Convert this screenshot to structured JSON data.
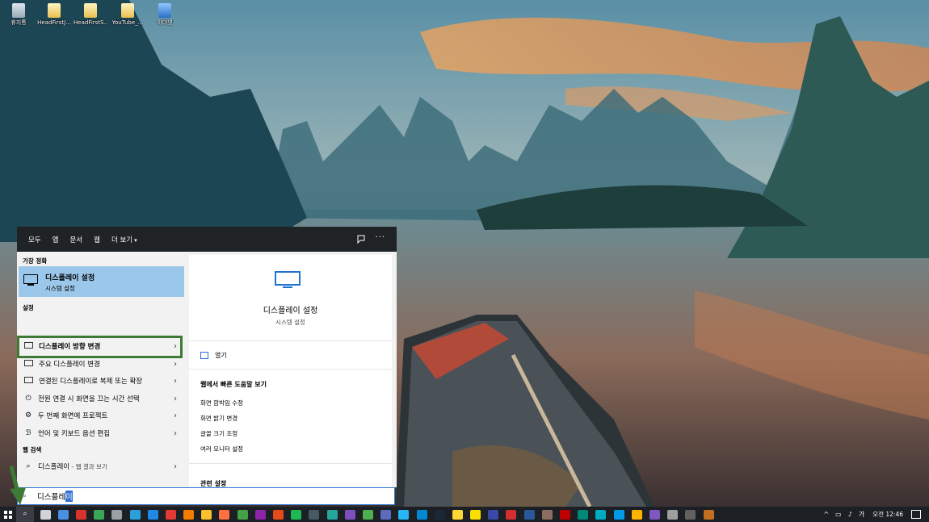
{
  "desktop": {
    "icons": [
      {
        "label": "휴지통",
        "icon": "recycle-bin-icon"
      },
      {
        "label": "HeadFirstJ...",
        "icon": "file-icon"
      },
      {
        "label": "HeadFirstS...",
        "icon": "file-icon"
      },
      {
        "label": "YouTube_...",
        "icon": "file-icon"
      },
      {
        "label": "이더넷",
        "icon": "network-icon"
      }
    ]
  },
  "search_panel": {
    "tabs": [
      {
        "label": "모두"
      },
      {
        "label": "앱"
      },
      {
        "label": "문서"
      },
      {
        "label": "웹"
      },
      {
        "label": "더 보기"
      }
    ],
    "more_caret": "▾",
    "more_options": "···",
    "best_match_title": "가장 정확",
    "best_match": {
      "title": "디스플레이 설정",
      "subtitle": "시스템 설정"
    },
    "settings_title": "설정",
    "settings_items": [
      {
        "label": "디스플레이 방향 변경",
        "icon": "monitor-icon"
      },
      {
        "label": "주요 디스플레이 변경",
        "icon": "monitor-icon"
      },
      {
        "label": "연결된 디스플레이로 복제 또는 확장",
        "icon": "monitor-icon"
      },
      {
        "label": "전원 연결 시 화면을 끄는 시간 선택",
        "icon": "power-icon"
      },
      {
        "label": "두 번째 화면에 프로젝트",
        "icon": "gear-icon"
      },
      {
        "label": "언어 및 키보드 옵션 편집",
        "icon": "language-icon"
      }
    ],
    "web_search_title": "웹 검색",
    "web_search_item": {
      "label": "디스플레이",
      "suffix": " - 웹 결과 보기"
    },
    "detail": {
      "title": "디스플레이 설정",
      "subtitle": "시스템 설정",
      "open_label": "열기",
      "web_help_title": "웹에서 빠른 도움말 보기",
      "help_links": [
        "화면 깜박임 수정",
        "화면 밝기 변경",
        "글꼴 크기 조정",
        "여러 모니터 설정"
      ],
      "related_title": "관련 설정"
    }
  },
  "search_box": {
    "query_prefix": "디스플레",
    "query_selected": "이"
  },
  "taskbar": {
    "apps": [
      {
        "icon": "task-view-icon",
        "color": "#cfd3d8"
      },
      {
        "icon": "mail-icon",
        "color": "#4a90e2"
      },
      {
        "icon": "acrobat-icon",
        "color": "#d9342b"
      },
      {
        "icon": "chrome-icon",
        "color": "#3aa757"
      },
      {
        "icon": "clock-icon",
        "color": "#9aa0a6"
      },
      {
        "icon": "edge-icon",
        "color": "#2b9fd9"
      },
      {
        "icon": "ie-icon",
        "color": "#1e88e5"
      },
      {
        "icon": "opera-icon",
        "color": "#e53935"
      },
      {
        "icon": "firefox-icon",
        "color": "#f57c00"
      },
      {
        "icon": "chrome-icon",
        "color": "#fbc02d"
      },
      {
        "icon": "firefox-icon",
        "color": "#ff7043"
      },
      {
        "icon": "app-icon",
        "color": "#43a047"
      },
      {
        "icon": "app-icon",
        "color": "#8e24aa"
      },
      {
        "icon": "app-icon",
        "color": "#e64a19"
      },
      {
        "icon": "spotify-icon",
        "color": "#1db954"
      },
      {
        "icon": "app-icon",
        "color": "#455a64"
      },
      {
        "icon": "app-icon",
        "color": "#26a69a"
      },
      {
        "icon": "visual-studio-icon",
        "color": "#7b4fbf"
      },
      {
        "icon": "app-icon",
        "color": "#4caf50"
      },
      {
        "icon": "app-icon",
        "color": "#5c6bc0"
      },
      {
        "icon": "app-icon",
        "color": "#29b6f6"
      },
      {
        "icon": "app-icon",
        "color": "#0288d1"
      },
      {
        "icon": "steam-icon",
        "color": "#1b2838"
      },
      {
        "icon": "app-icon",
        "color": "#fdd835"
      },
      {
        "icon": "kakaotalk-icon",
        "color": "#f9e000"
      },
      {
        "icon": "app-icon",
        "color": "#3949ab"
      },
      {
        "icon": "app-icon",
        "color": "#d32f2f"
      },
      {
        "icon": "word-icon",
        "color": "#2b579a"
      },
      {
        "icon": "app-icon",
        "color": "#8d6e63"
      },
      {
        "icon": "filezilla-icon",
        "color": "#bf0000"
      },
      {
        "icon": "app-icon",
        "color": "#00897b"
      },
      {
        "icon": "app-icon",
        "color": "#00acc1"
      },
      {
        "icon": "app-icon",
        "color": "#039be5"
      },
      {
        "icon": "app-icon",
        "color": "#ffb300"
      },
      {
        "icon": "app-icon",
        "color": "#7e57c2"
      },
      {
        "icon": "app-icon",
        "color": "#9e9e9e"
      },
      {
        "icon": "app-icon",
        "color": "#616161"
      },
      {
        "icon": "obs-icon",
        "color": "#c07020"
      }
    ],
    "tray": {
      "chevron": "^",
      "ime_label": "가",
      "time": "오전 12:46"
    }
  }
}
